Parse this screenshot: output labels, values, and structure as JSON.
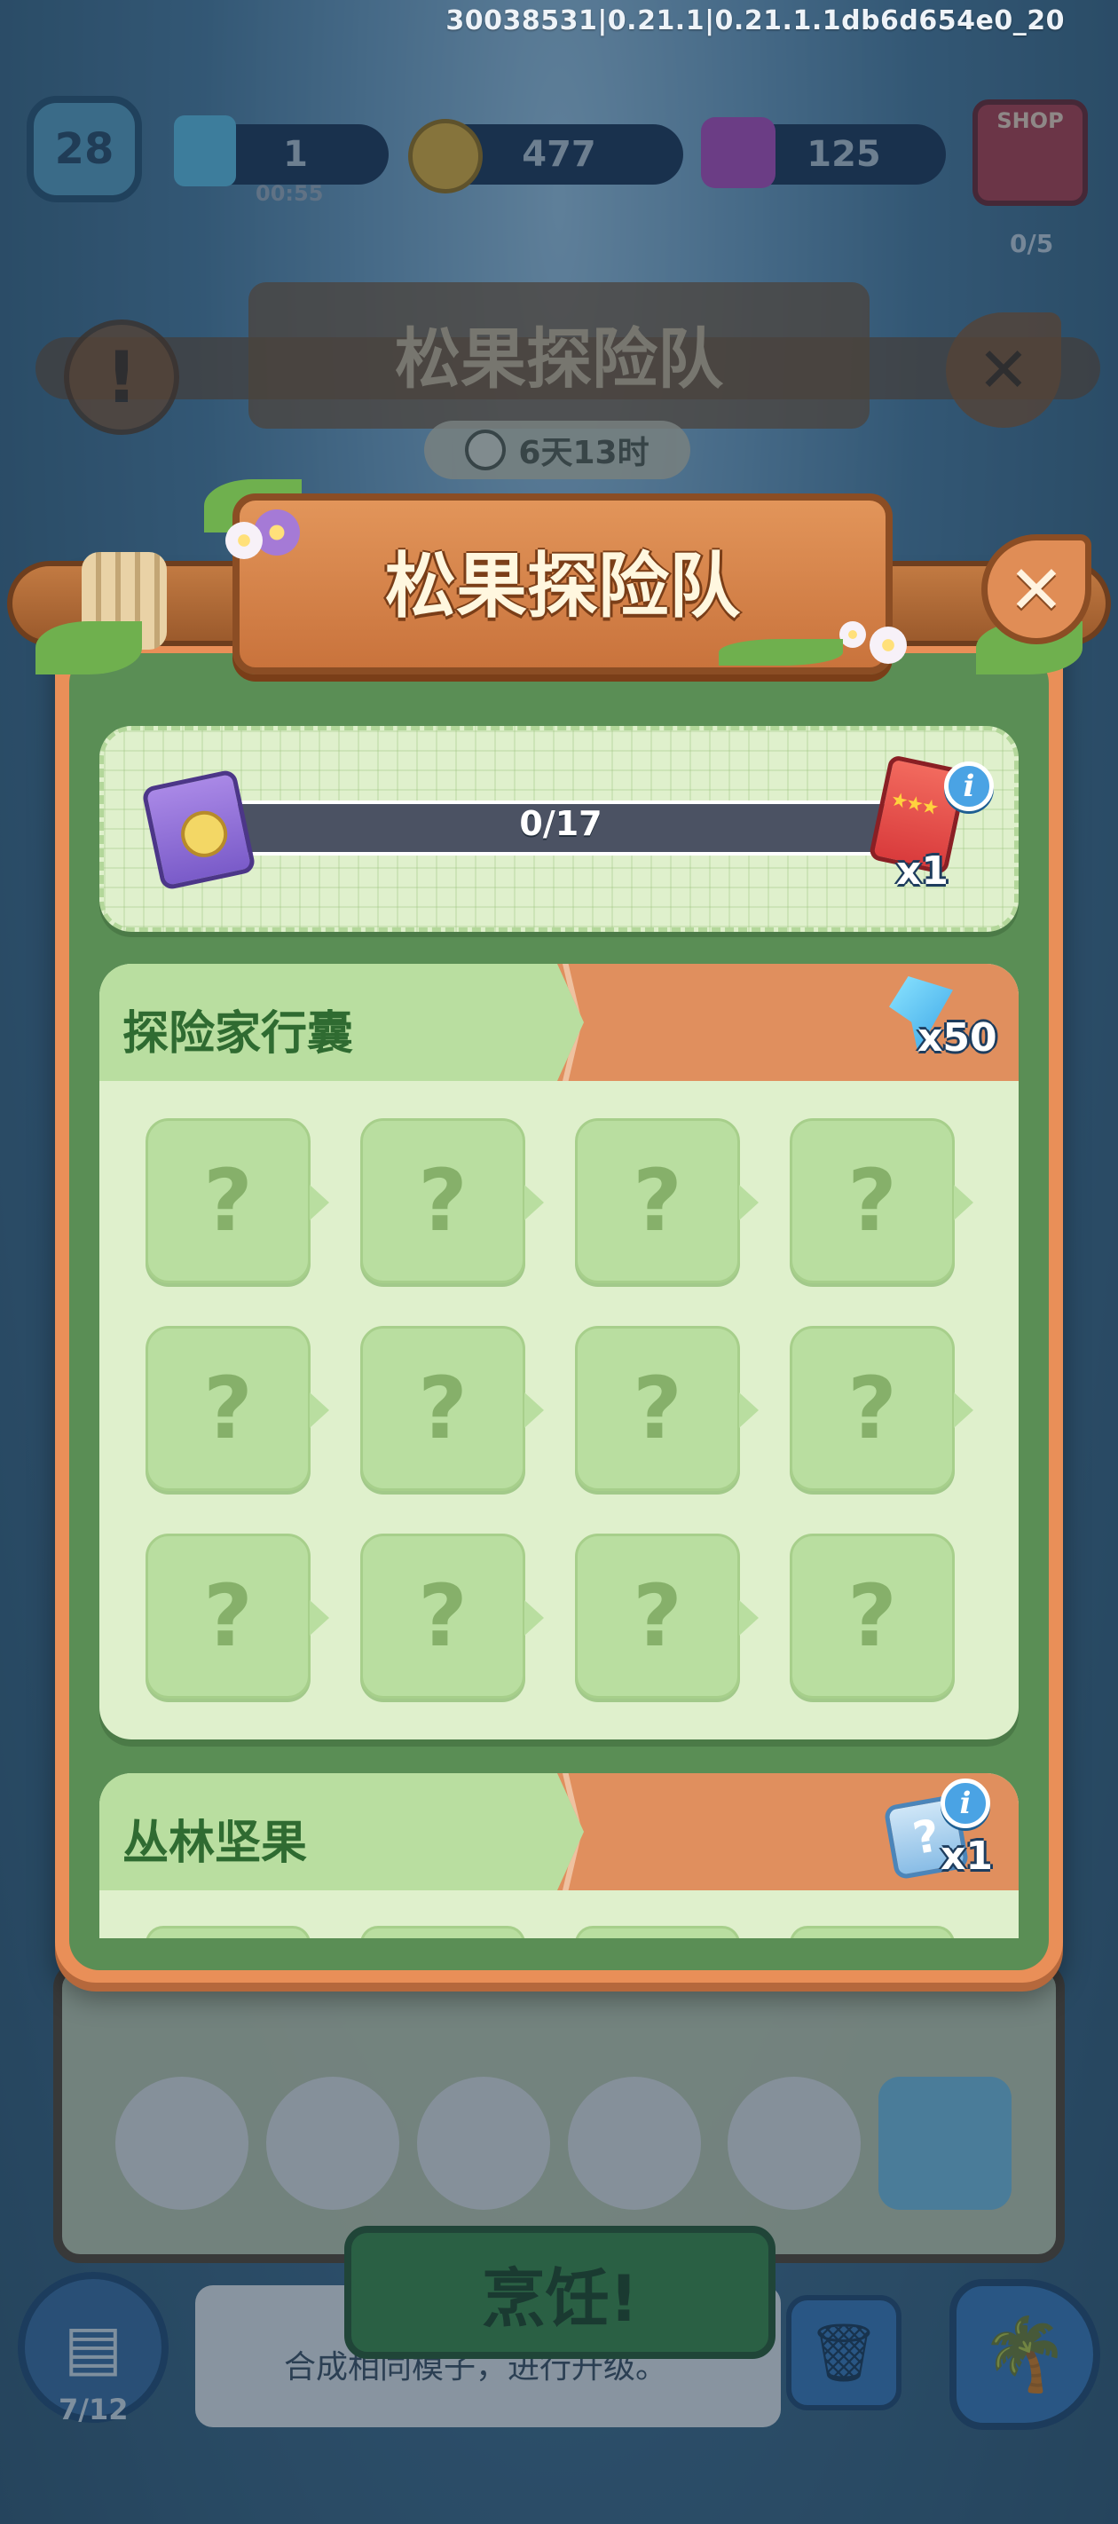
{
  "build_version": "30038531|0.21.1|0.21.1.1db6d654e0_20",
  "hud": {
    "level": "28",
    "energy": "1",
    "energy_timer": "00:55",
    "coins": "477",
    "gems": "125",
    "shop_label": "SHOP",
    "task_counter": "0/5"
  },
  "background_event": {
    "title": "松果探险队",
    "time_left": "6天13时"
  },
  "popup": {
    "title": "松果探险队",
    "close_icon": "leaf-close-icon",
    "progress": {
      "current": 0,
      "total": 17,
      "text": "0/17",
      "reward_count": "x1"
    },
    "sections": [
      {
        "title": "探险家行囊",
        "reward_count": "x50",
        "reward_icon": "blue-gem-icon",
        "slots": [
          "?",
          "?",
          "?",
          "?",
          "?",
          "?",
          "?",
          "?",
          "?",
          "?",
          "?",
          "?"
        ]
      },
      {
        "title": "丛林坚果",
        "reward_count": "x1",
        "reward_icon": "mystery-box-icon"
      }
    ]
  },
  "bottom": {
    "cook_button": "烹饪!",
    "hint": "合成相同模子，进行升级。",
    "fridge_count": "7/12"
  },
  "colors": {
    "popup_border": "#e98f58",
    "popup_inner": "#5a8e55",
    "card": "#dff0cc",
    "slot": "#b9dea0",
    "ribbon": "#e08f5e",
    "progress_bar": "#4b5263",
    "title_text": "#fff7df"
  }
}
